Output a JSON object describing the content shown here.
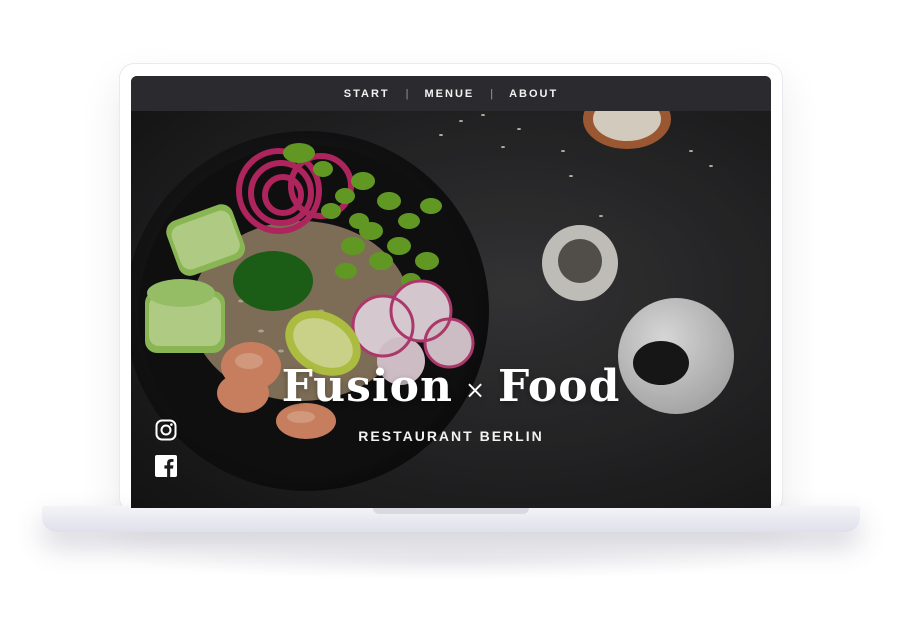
{
  "nav": {
    "items": [
      {
        "label": "START"
      },
      {
        "label": "MENUE"
      },
      {
        "label": "ABOUT"
      }
    ],
    "separator": "|"
  },
  "hero": {
    "title_left": "Fusion",
    "title_times": "×",
    "title_right": "Food",
    "subtitle": "RESTAURANT BERLIN"
  },
  "social": {
    "icons": [
      "instagram-icon",
      "facebook-icon"
    ]
  },
  "colors": {
    "nav_bg": "#2b2b2f",
    "hero_bg": "#1c1c1e",
    "text": "#ffffff"
  }
}
